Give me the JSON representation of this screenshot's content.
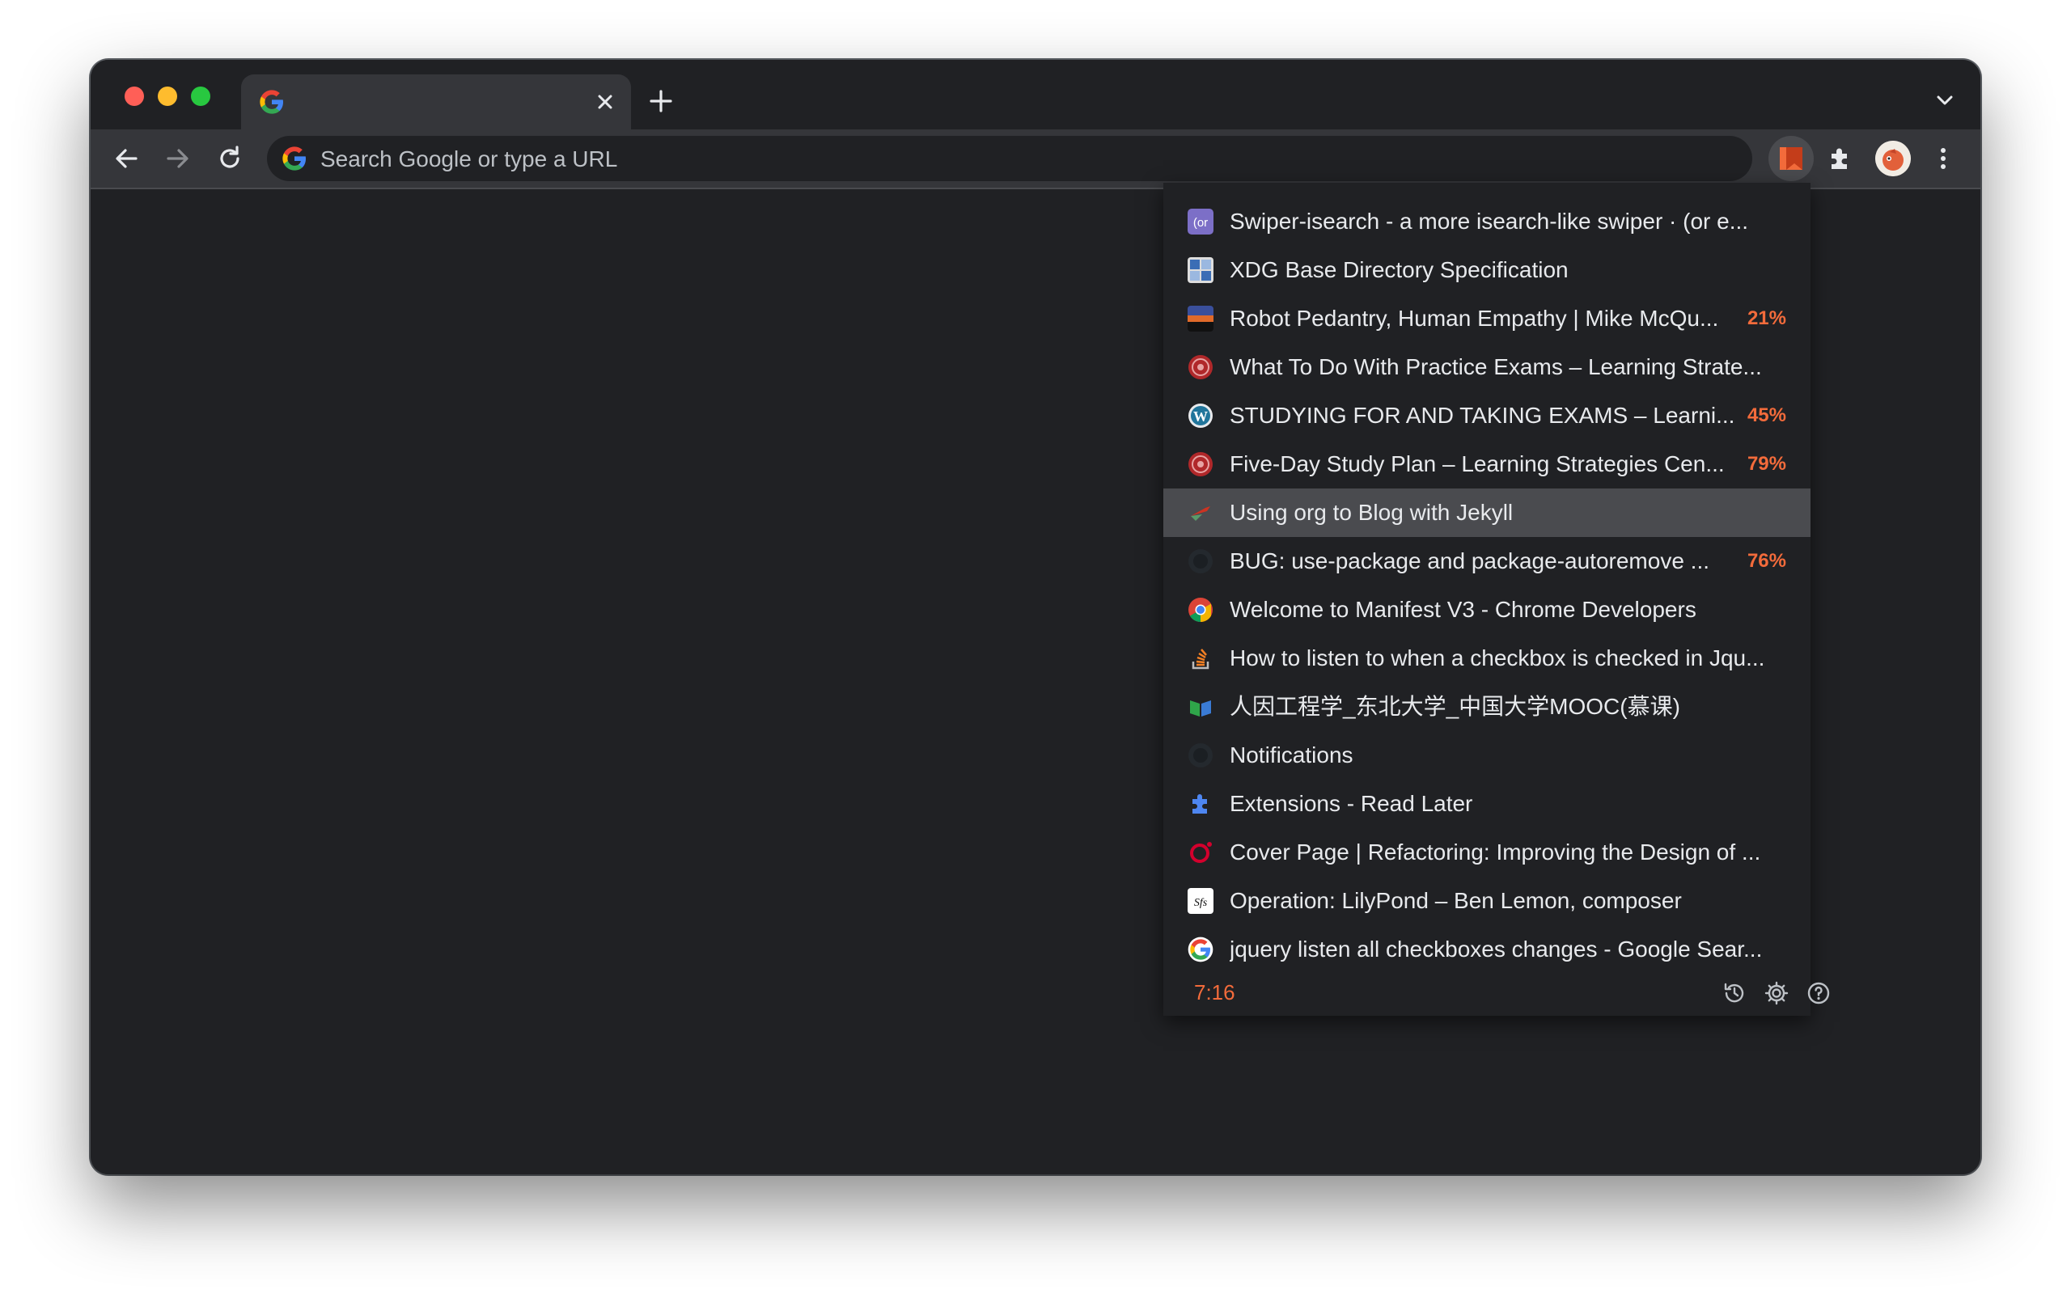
{
  "browser": {
    "tab": {
      "title": "",
      "favicon": "google-g-icon"
    },
    "omnibox": {
      "placeholder": "Search Google or type a URL"
    }
  },
  "popup": {
    "items": [
      {
        "title": "Swiper-isearch - a more isearch-like swiper · (or e...",
        "percent": "",
        "icon": "org-icon",
        "icon_color": "#7c6fc7"
      },
      {
        "title": "XDG Base Directory Specification",
        "percent": "",
        "icon": "freedesktop-icon",
        "icon_color": "#3b6db5"
      },
      {
        "title": "Robot Pedantry, Human Empathy | Mike McQu...",
        "percent": "21%",
        "icon": "sunset-icon",
        "icon_color": "#e06a2a"
      },
      {
        "title": "What To Do With Practice Exams – Learning Strate...",
        "percent": "",
        "icon": "university-seal-icon",
        "icon_color": "#b0282a"
      },
      {
        "title": "STUDYING FOR AND TAKING EXAMS – Learni...",
        "percent": "45%",
        "icon": "wordpress-icon",
        "icon_color": "#e8eaed"
      },
      {
        "title": "Five-Day Study Plan – Learning Strategies Cen...",
        "percent": "79%",
        "icon": "university-seal-icon",
        "icon_color": "#b0282a"
      },
      {
        "title": "Using org to Blog with Jekyll",
        "percent": "",
        "icon": "jekyll-icon",
        "icon_color": "#cc3322"
      },
      {
        "title": "BUG: use-package and package-autoremove ...",
        "percent": "76%",
        "icon": "github-icon",
        "icon_color": "#24292e"
      },
      {
        "title": "Welcome to Manifest V3 - Chrome Developers",
        "percent": "",
        "icon": "chrome-icon",
        "icon_color": "#4285f4"
      },
      {
        "title": "How to listen to when a checkbox is checked in Jqu...",
        "percent": "",
        "icon": "stackoverflow-icon",
        "icon_color": "#f48024"
      },
      {
        "title": "人因工程学_东北大学_中国大学MOOC(慕课)",
        "percent": "",
        "icon": "mooc-icon",
        "icon_color": "#2fa54a"
      },
      {
        "title": "Notifications",
        "percent": "",
        "icon": "github-icon",
        "icon_color": "#24292e"
      },
      {
        "title": "Extensions - Read Later",
        "percent": "",
        "icon": "puzzle-icon",
        "icon_color": "#4e86f1"
      },
      {
        "title": "Cover Page | Refactoring: Improving the Design of ...",
        "percent": "",
        "icon": "oreilly-icon",
        "icon_color": "#d3002d"
      },
      {
        "title": "Operation: LilyPond – Ben Lemon, composer",
        "percent": "",
        "icon": "sfs-icon",
        "icon_color": "#ffffff"
      },
      {
        "title": "jquery listen all checkboxes changes - Google Sear...",
        "percent": "",
        "icon": "google-g-icon",
        "icon_color": "#4285f4"
      }
    ],
    "selected_index": 6,
    "footer": {
      "time": "7:16"
    }
  },
  "colors": {
    "accent": "#f36b3b",
    "window_bg": "#202124",
    "toolbar_bg": "#35363a",
    "selected_row": "#4a4b4f"
  }
}
